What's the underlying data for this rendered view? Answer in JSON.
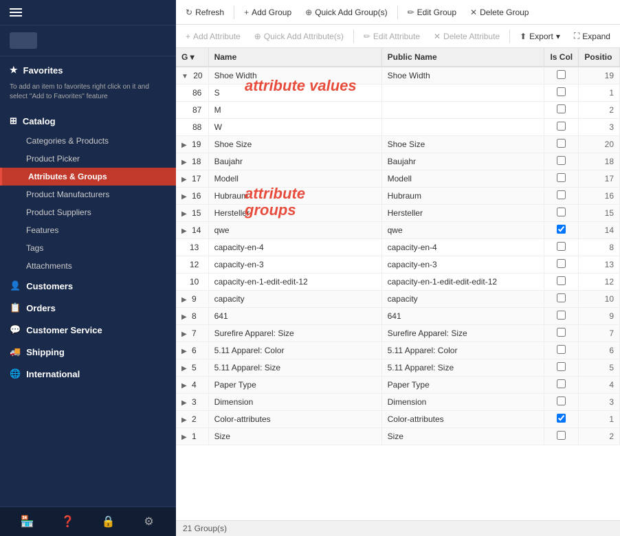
{
  "sidebar": {
    "hamburger_label": "menu",
    "favorites": {
      "label": "Favorites",
      "hint": "To add an item to favorites right click on it and select \"Add to Favorites\" feature"
    },
    "catalog": {
      "label": "Catalog",
      "items": [
        {
          "id": "categories-products",
          "label": "Categories & Products",
          "active": false
        },
        {
          "id": "product-picker",
          "label": "Product Picker",
          "active": false
        },
        {
          "id": "attributes-groups",
          "label": "Attributes & Groups",
          "active": true
        },
        {
          "id": "product-manufacturers",
          "label": "Product Manufacturers",
          "active": false
        },
        {
          "id": "product-suppliers",
          "label": "Product Suppliers",
          "active": false
        },
        {
          "id": "features",
          "label": "Features",
          "active": false
        },
        {
          "id": "tags",
          "label": "Tags",
          "active": false
        },
        {
          "id": "attachments",
          "label": "Attachments",
          "active": false
        }
      ]
    },
    "customers": {
      "label": "Customers"
    },
    "orders": {
      "label": "Orders"
    },
    "customer_service": {
      "label": "Customer Service"
    },
    "shipping": {
      "label": "Shipping"
    },
    "international": {
      "label": "International"
    },
    "footer_icons": [
      "store-icon",
      "help-icon",
      "lock-icon",
      "settings-icon"
    ]
  },
  "toolbar_top": {
    "buttons": [
      {
        "id": "refresh",
        "label": "Refresh",
        "icon": "↻",
        "disabled": false
      },
      {
        "id": "add-group",
        "label": "Add Group",
        "icon": "+",
        "disabled": false
      },
      {
        "id": "quick-add-groups",
        "label": "Quick Add Group(s)",
        "icon": "⊕",
        "disabled": false
      },
      {
        "id": "edit-group",
        "label": "Edit Group",
        "icon": "✏",
        "disabled": false
      },
      {
        "id": "delete-group",
        "label": "Delete Group",
        "icon": "✕",
        "disabled": false
      }
    ]
  },
  "toolbar_bottom": {
    "buttons": [
      {
        "id": "add-attribute",
        "label": "Add Attribute",
        "icon": "+",
        "disabled": true
      },
      {
        "id": "quick-add-attributes",
        "label": "Quick Add Attribute(s)",
        "icon": "⊕",
        "disabled": true
      },
      {
        "id": "edit-attribute",
        "label": "Edit Attribute",
        "icon": "✏",
        "disabled": true
      },
      {
        "id": "delete-attribute",
        "label": "Delete Attribute",
        "icon": "✕",
        "disabled": true
      },
      {
        "id": "export",
        "label": "Export",
        "icon": "⬆",
        "disabled": false
      },
      {
        "id": "expand",
        "label": "Expand",
        "icon": "⛶",
        "disabled": false
      }
    ]
  },
  "table": {
    "columns": [
      "G",
      "Name",
      "Public Name",
      "Is Col",
      "Positio"
    ],
    "rows": [
      {
        "type": "group",
        "expanded": true,
        "id": "20",
        "name": "Shoe Width",
        "public_name": "Shoe Width",
        "is_col": false,
        "position": "19",
        "children": [
          {
            "id": "86",
            "name": "S",
            "public_name": "",
            "is_col": false,
            "position": "1"
          },
          {
            "id": "87",
            "name": "M",
            "public_name": "",
            "is_col": false,
            "position": "2"
          },
          {
            "id": "88",
            "name": "W",
            "public_name": "",
            "is_col": false,
            "position": "3"
          }
        ]
      },
      {
        "type": "group",
        "expanded": false,
        "id": "19",
        "name": "Shoe Size",
        "public_name": "Shoe Size",
        "is_col": false,
        "position": "20"
      },
      {
        "type": "group",
        "expanded": false,
        "id": "18",
        "name": "Baujahr",
        "public_name": "Baujahr",
        "is_col": false,
        "position": "18"
      },
      {
        "type": "group",
        "expanded": false,
        "id": "17",
        "name": "Modell",
        "public_name": "Modell",
        "is_col": false,
        "position": "17"
      },
      {
        "type": "group",
        "expanded": false,
        "id": "16",
        "name": "Hubraum",
        "public_name": "Hubraum",
        "is_col": false,
        "position": "16"
      },
      {
        "type": "group",
        "expanded": false,
        "id": "15",
        "name": "Hersteller",
        "public_name": "Hersteller",
        "is_col": false,
        "position": "15"
      },
      {
        "type": "group",
        "expanded": false,
        "id": "14",
        "name": "qwe",
        "public_name": "qwe",
        "is_col": true,
        "position": "14"
      },
      {
        "type": "flat",
        "id": "13",
        "name": "capacity-en-4",
        "public_name": "capacity-en-4",
        "is_col": false,
        "position": "8"
      },
      {
        "type": "flat",
        "id": "12",
        "name": "capacity-en-3",
        "public_name": "capacity-en-3",
        "is_col": false,
        "position": "13"
      },
      {
        "type": "flat",
        "id": "10",
        "name": "capacity-en-1-edit-edit-12",
        "public_name": "capacity-en-1-edit-edit-edit-12",
        "is_col": false,
        "position": "12"
      },
      {
        "type": "group",
        "expanded": false,
        "id": "9",
        "name": "capacity",
        "public_name": "capacity",
        "is_col": false,
        "position": "10"
      },
      {
        "type": "group",
        "expanded": false,
        "id": "8",
        "name": "641",
        "public_name": "641",
        "is_col": false,
        "position": "9"
      },
      {
        "type": "group",
        "expanded": false,
        "id": "7",
        "name": "Surefire Apparel: Size",
        "public_name": "Surefire Apparel: Size",
        "is_col": false,
        "position": "7"
      },
      {
        "type": "group",
        "expanded": false,
        "id": "6",
        "name": "5.11 Apparel: Color",
        "public_name": "5.11 Apparel: Color",
        "is_col": false,
        "position": "6"
      },
      {
        "type": "group",
        "expanded": false,
        "id": "5",
        "name": "5.11 Apparel: Size",
        "public_name": "5.11 Apparel: Size",
        "is_col": false,
        "position": "5"
      },
      {
        "type": "group",
        "expanded": false,
        "id": "4",
        "name": "Paper Type",
        "public_name": "Paper Type",
        "is_col": false,
        "position": "4"
      },
      {
        "type": "group",
        "expanded": false,
        "id": "3",
        "name": "Dimension",
        "public_name": "Dimension",
        "is_col": false,
        "position": "3"
      },
      {
        "type": "group",
        "expanded": false,
        "id": "2",
        "name": "Color-attributes",
        "public_name": "Color-attributes",
        "is_col": true,
        "position": "1"
      },
      {
        "type": "group",
        "expanded": false,
        "id": "1",
        "name": "Size",
        "public_name": "Size",
        "is_col": false,
        "position": "2"
      }
    ]
  },
  "annotations": {
    "attribute_values": "attribute values",
    "attribute_groups": "attribute\ngroups"
  },
  "status_bar": {
    "text": "21 Group(s)"
  }
}
